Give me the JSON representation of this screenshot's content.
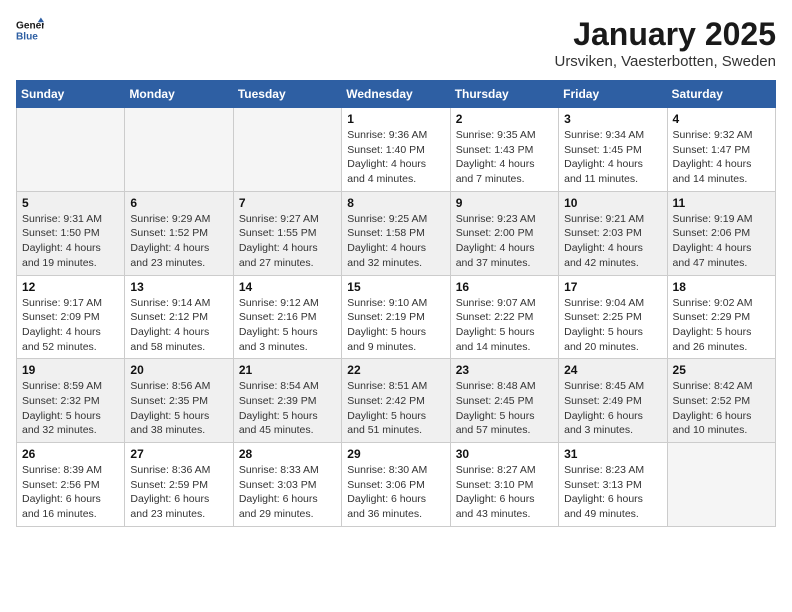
{
  "header": {
    "logo_line1": "General",
    "logo_line2": "Blue",
    "month": "January 2025",
    "location": "Ursviken, Vaesterbotten, Sweden"
  },
  "weekdays": [
    "Sunday",
    "Monday",
    "Tuesday",
    "Wednesday",
    "Thursday",
    "Friday",
    "Saturday"
  ],
  "weeks": [
    [
      {
        "day": "",
        "info": ""
      },
      {
        "day": "",
        "info": ""
      },
      {
        "day": "",
        "info": ""
      },
      {
        "day": "1",
        "info": "Sunrise: 9:36 AM\nSunset: 1:40 PM\nDaylight: 4 hours\nand 4 minutes."
      },
      {
        "day": "2",
        "info": "Sunrise: 9:35 AM\nSunset: 1:43 PM\nDaylight: 4 hours\nand 7 minutes."
      },
      {
        "day": "3",
        "info": "Sunrise: 9:34 AM\nSunset: 1:45 PM\nDaylight: 4 hours\nand 11 minutes."
      },
      {
        "day": "4",
        "info": "Sunrise: 9:32 AM\nSunset: 1:47 PM\nDaylight: 4 hours\nand 14 minutes."
      }
    ],
    [
      {
        "day": "5",
        "info": "Sunrise: 9:31 AM\nSunset: 1:50 PM\nDaylight: 4 hours\nand 19 minutes."
      },
      {
        "day": "6",
        "info": "Sunrise: 9:29 AM\nSunset: 1:52 PM\nDaylight: 4 hours\nand 23 minutes."
      },
      {
        "day": "7",
        "info": "Sunrise: 9:27 AM\nSunset: 1:55 PM\nDaylight: 4 hours\nand 27 minutes."
      },
      {
        "day": "8",
        "info": "Sunrise: 9:25 AM\nSunset: 1:58 PM\nDaylight: 4 hours\nand 32 minutes."
      },
      {
        "day": "9",
        "info": "Sunrise: 9:23 AM\nSunset: 2:00 PM\nDaylight: 4 hours\nand 37 minutes."
      },
      {
        "day": "10",
        "info": "Sunrise: 9:21 AM\nSunset: 2:03 PM\nDaylight: 4 hours\nand 42 minutes."
      },
      {
        "day": "11",
        "info": "Sunrise: 9:19 AM\nSunset: 2:06 PM\nDaylight: 4 hours\nand 47 minutes."
      }
    ],
    [
      {
        "day": "12",
        "info": "Sunrise: 9:17 AM\nSunset: 2:09 PM\nDaylight: 4 hours\nand 52 minutes."
      },
      {
        "day": "13",
        "info": "Sunrise: 9:14 AM\nSunset: 2:12 PM\nDaylight: 4 hours\nand 58 minutes."
      },
      {
        "day": "14",
        "info": "Sunrise: 9:12 AM\nSunset: 2:16 PM\nDaylight: 5 hours\nand 3 minutes."
      },
      {
        "day": "15",
        "info": "Sunrise: 9:10 AM\nSunset: 2:19 PM\nDaylight: 5 hours\nand 9 minutes."
      },
      {
        "day": "16",
        "info": "Sunrise: 9:07 AM\nSunset: 2:22 PM\nDaylight: 5 hours\nand 14 minutes."
      },
      {
        "day": "17",
        "info": "Sunrise: 9:04 AM\nSunset: 2:25 PM\nDaylight: 5 hours\nand 20 minutes."
      },
      {
        "day": "18",
        "info": "Sunrise: 9:02 AM\nSunset: 2:29 PM\nDaylight: 5 hours\nand 26 minutes."
      }
    ],
    [
      {
        "day": "19",
        "info": "Sunrise: 8:59 AM\nSunset: 2:32 PM\nDaylight: 5 hours\nand 32 minutes."
      },
      {
        "day": "20",
        "info": "Sunrise: 8:56 AM\nSunset: 2:35 PM\nDaylight: 5 hours\nand 38 minutes."
      },
      {
        "day": "21",
        "info": "Sunrise: 8:54 AM\nSunset: 2:39 PM\nDaylight: 5 hours\nand 45 minutes."
      },
      {
        "day": "22",
        "info": "Sunrise: 8:51 AM\nSunset: 2:42 PM\nDaylight: 5 hours\nand 51 minutes."
      },
      {
        "day": "23",
        "info": "Sunrise: 8:48 AM\nSunset: 2:45 PM\nDaylight: 5 hours\nand 57 minutes."
      },
      {
        "day": "24",
        "info": "Sunrise: 8:45 AM\nSunset: 2:49 PM\nDaylight: 6 hours\nand 3 minutes."
      },
      {
        "day": "25",
        "info": "Sunrise: 8:42 AM\nSunset: 2:52 PM\nDaylight: 6 hours\nand 10 minutes."
      }
    ],
    [
      {
        "day": "26",
        "info": "Sunrise: 8:39 AM\nSunset: 2:56 PM\nDaylight: 6 hours\nand 16 minutes."
      },
      {
        "day": "27",
        "info": "Sunrise: 8:36 AM\nSunset: 2:59 PM\nDaylight: 6 hours\nand 23 minutes."
      },
      {
        "day": "28",
        "info": "Sunrise: 8:33 AM\nSunset: 3:03 PM\nDaylight: 6 hours\nand 29 minutes."
      },
      {
        "day": "29",
        "info": "Sunrise: 8:30 AM\nSunset: 3:06 PM\nDaylight: 6 hours\nand 36 minutes."
      },
      {
        "day": "30",
        "info": "Sunrise: 8:27 AM\nSunset: 3:10 PM\nDaylight: 6 hours\nand 43 minutes."
      },
      {
        "day": "31",
        "info": "Sunrise: 8:23 AM\nSunset: 3:13 PM\nDaylight: 6 hours\nand 49 minutes."
      },
      {
        "day": "",
        "info": ""
      }
    ]
  ]
}
